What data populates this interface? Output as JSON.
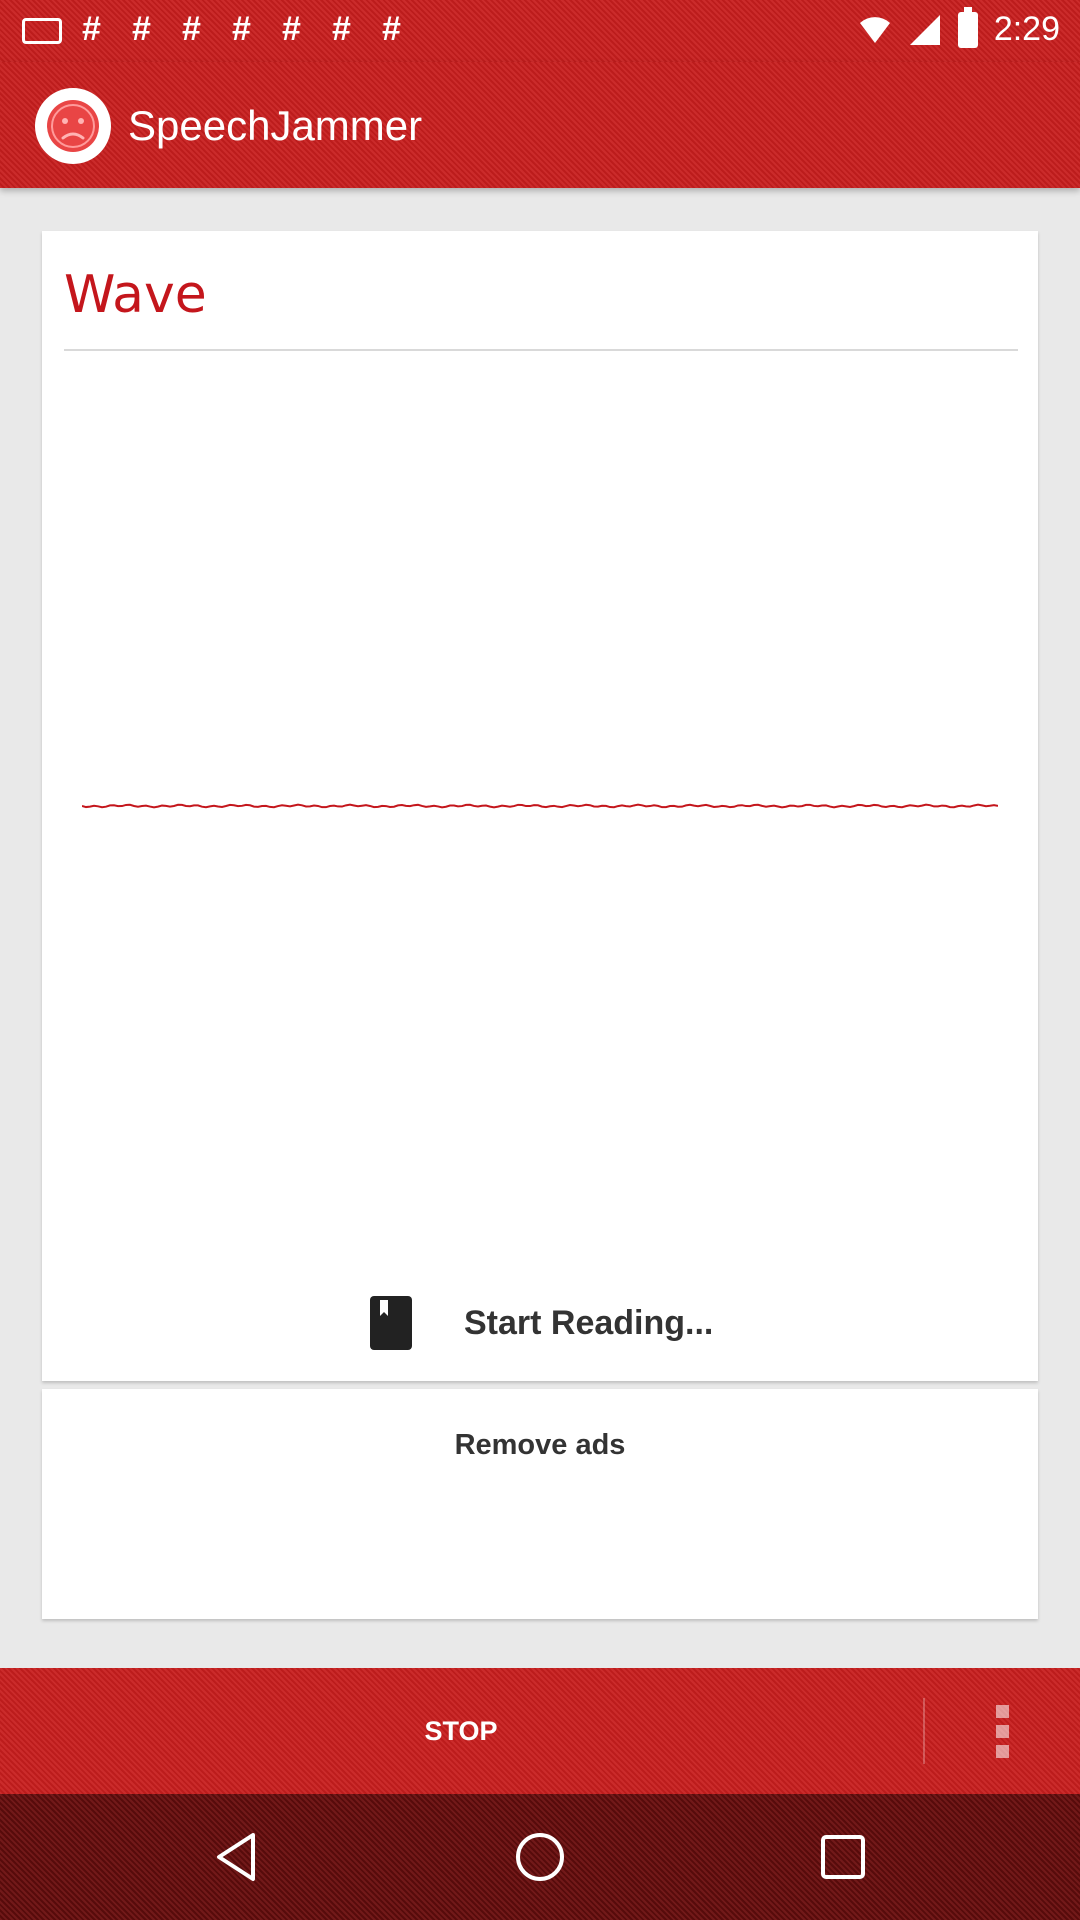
{
  "status_bar": {
    "time": "2:29",
    "notification_icons": [
      "mail-icon",
      "hash-icon",
      "hash-icon",
      "hash-icon",
      "hash-icon",
      "hash-icon",
      "hash-icon",
      "hash-icon"
    ]
  },
  "app_bar": {
    "title": "SpeechJammer",
    "logo_icon": "sad-face-icon"
  },
  "wave_card": {
    "title": "Wave",
    "action_label": "Start Reading...",
    "action_icon": "book-icon",
    "wave_color": "#c4161c"
  },
  "ads_card": {
    "label": "Remove ads"
  },
  "action_bar": {
    "stop_label": "STOP",
    "menu_icon": "more-vert-icon"
  },
  "nav_bar": {
    "buttons": [
      "back-icon",
      "home-icon",
      "recents-icon"
    ]
  },
  "colors": {
    "accent": "#c81e1e",
    "nav_background": "#6a0d0d"
  }
}
